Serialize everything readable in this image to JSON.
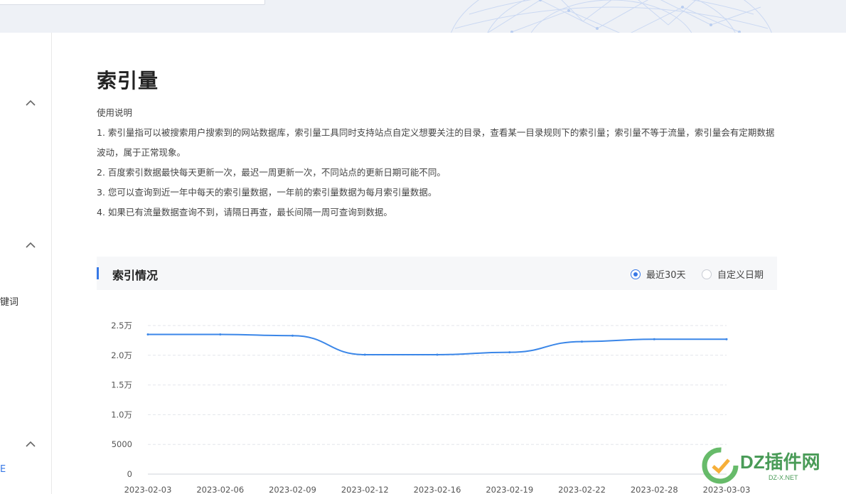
{
  "page": {
    "title": "索引量",
    "usage_heading": "使用说明",
    "usage_items": [
      "1. 索引量指可以被搜索用户搜索到的网站数据库，索引量工具同时支持站点自定义想要关注的目录，查看某一目录规则下的索引量；索引量不等于流量，索引量会有定期数据波动，属于正常现象。",
      "2. 百度索引数据最快每天更新一次，最迟一周更新一次，不同站点的更新日期可能不同。",
      "3. 您可以查询到近一年中每天的索引量数据，一年前的索引量数据为每月索引量数据。",
      "4. 如果已有流量数据查询不到，请隔日再查，最长间隔一周可查询到数据。"
    ]
  },
  "sidebar": {
    "partial_labels": [
      "键词",
      "E"
    ]
  },
  "panel": {
    "title": "索引情况",
    "options": [
      {
        "label": "最近30天",
        "selected": true
      },
      {
        "label": "自定义日期",
        "selected": false
      }
    ],
    "accent": "#3778e6"
  },
  "watermark": {
    "brand": "DZ插件网",
    "sub": "DZ-X.NET"
  },
  "chart_data": {
    "type": "line",
    "x": [
      "2023-02-03",
      "2023-02-06",
      "2023-02-09",
      "2023-02-12",
      "2023-02-16",
      "2023-02-19",
      "2023-02-22",
      "2023-02-28",
      "2023-03-03"
    ],
    "series": [
      {
        "values": [
          23500,
          23500,
          23300,
          20100,
          20100,
          20500,
          22300,
          22700,
          22700
        ]
      }
    ],
    "y_ticks": [
      "0",
      "5000",
      "1.0万",
      "1.5万",
      "2.0万",
      "2.5万"
    ],
    "ylim": [
      0,
      25000
    ],
    "grid": true,
    "color": "#3a86e8"
  }
}
